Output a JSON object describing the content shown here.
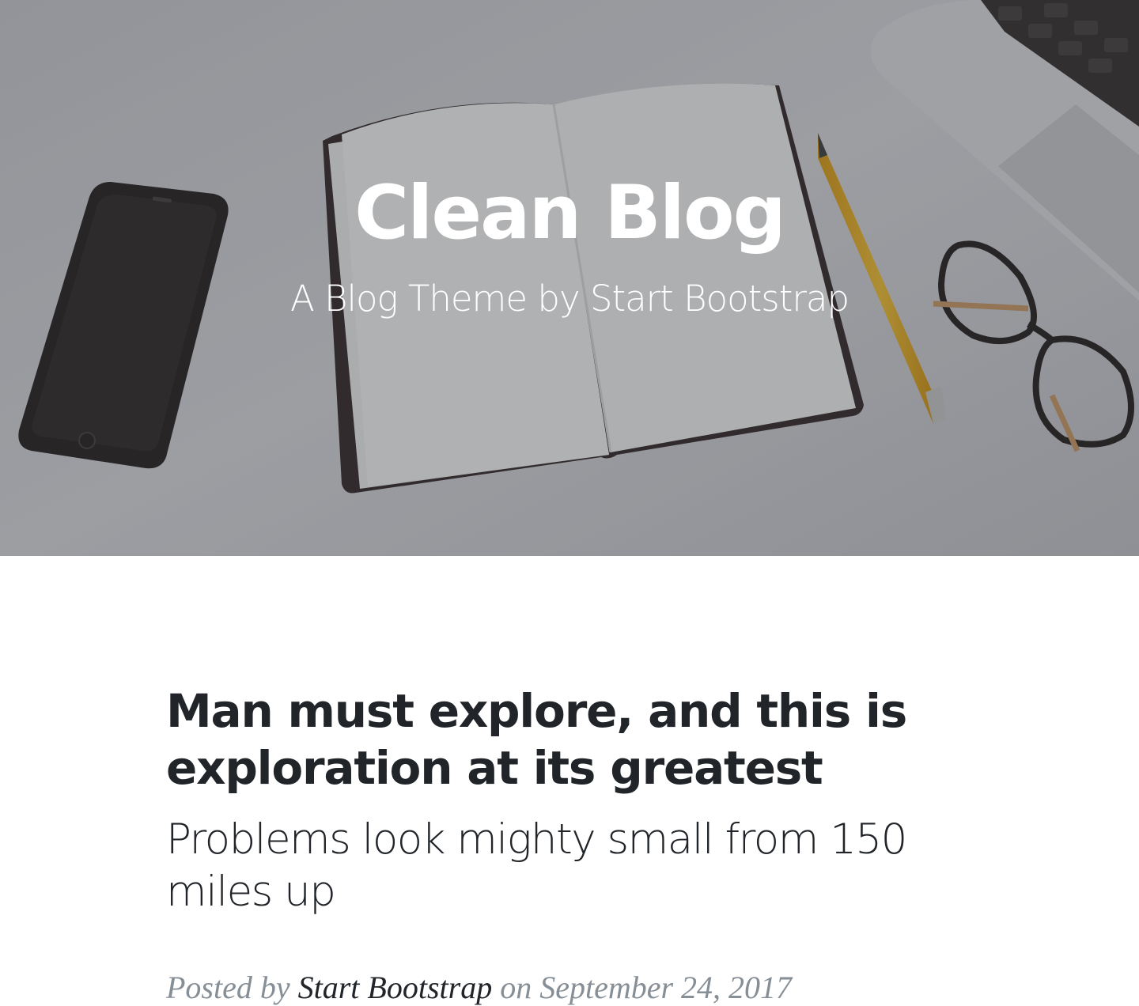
{
  "header": {
    "title": "Clean Blog",
    "subtitle": "A Blog Theme by Start Bootstrap"
  },
  "posts": [
    {
      "title": "Man must explore, and this is exploration at its greatest",
      "subtitle": "Problems look mighty small from 150 miles up",
      "meta_prefix": "Posted by",
      "author": "Start Bootstrap",
      "date_text": "on September 24, 2017"
    }
  ],
  "colors": {
    "text": "#212529",
    "meta": "#868e96",
    "hero_bg": "#8a8c92"
  }
}
